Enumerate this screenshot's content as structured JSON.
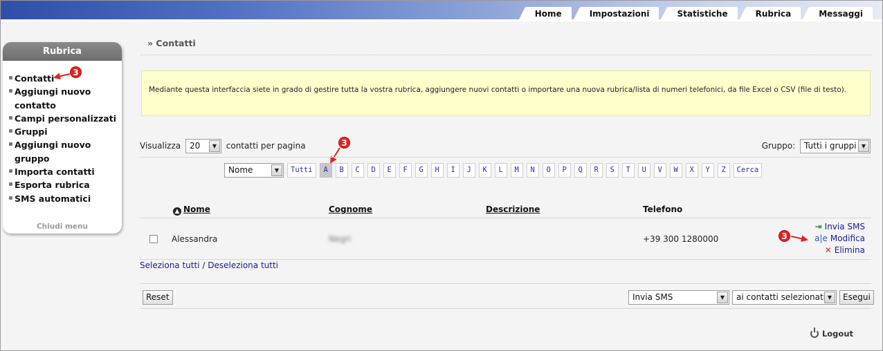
{
  "nav": {
    "tabs": [
      "Home",
      "Impostazioni",
      "Statistiche",
      "Rubrica",
      "Messaggi"
    ]
  },
  "sidebar": {
    "title": "Rubrica",
    "items": [
      {
        "label": "Contatti"
      },
      {
        "label": "Aggiungi nuovo contatto"
      },
      {
        "label": "Campi personalizzati"
      },
      {
        "label": "Gruppi"
      },
      {
        "label": "Aggiungi nuovo gruppo"
      },
      {
        "label": "Importa contatti"
      },
      {
        "label": "Esporta rubrica"
      },
      {
        "label": "SMS automatici"
      }
    ],
    "close_label": "Chiudi menu"
  },
  "markers": {
    "label": "3",
    "color": "#e8201c"
  },
  "breadcrumb": {
    "text": "» Contatti"
  },
  "notice": {
    "text": "Mediante questa interfaccia siete in grado di gestire tutta la vostra rubrica, aggiungere nuovi contatti o importare una nuova rubrica/lista di numeri telefonici, da file Excel o CSV (file di testo)."
  },
  "pagination": {
    "label_before": "Visualizza",
    "per_page": "20",
    "label_after": "contatti per pagina"
  },
  "group_filter": {
    "label": "Gruppo:",
    "value": "Tutti i gruppi"
  },
  "alpha_filter": {
    "field": "Nome",
    "all_label": "Tutti",
    "letters": [
      "A",
      "B",
      "C",
      "D",
      "E",
      "F",
      "G",
      "H",
      "I",
      "J",
      "K",
      "L",
      "M",
      "N",
      "O",
      "P",
      "Q",
      "R",
      "S",
      "T",
      "U",
      "V",
      "W",
      "X",
      "Y",
      "Z"
    ],
    "active": "A",
    "search_label": "Cerca"
  },
  "table": {
    "columns": {
      "name": "Nome",
      "surname": "Cognome",
      "description": "Descrizione",
      "phone": "Telefono"
    },
    "rows": [
      {
        "name": "Alessandra",
        "surname": "Negri",
        "description": "",
        "phone": "+39 300 1280000"
      }
    ],
    "actions": {
      "send": "Invia SMS",
      "edit": "Modifica",
      "delete": "Elimina"
    }
  },
  "selection": {
    "select_all": "Seleziona tutti",
    "separator": "/",
    "deselect_all": "Deseleziona tutti"
  },
  "bulk": {
    "reset_label": "Reset",
    "action": "Invia SMS",
    "target": "ai contatti selezionati",
    "execute_label": "Esegui"
  },
  "logout": {
    "label": "Logout"
  }
}
